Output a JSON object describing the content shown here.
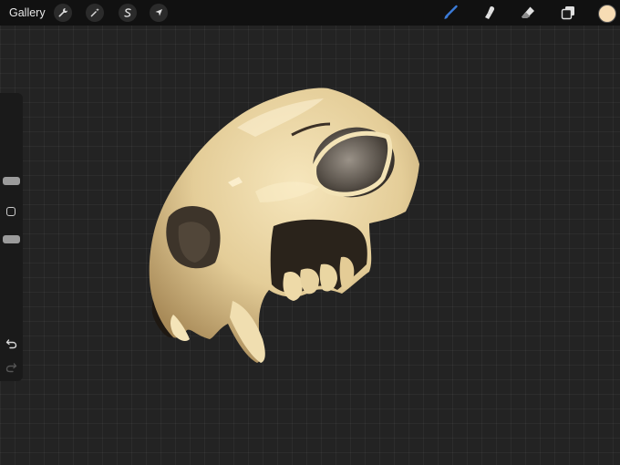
{
  "topbar": {
    "gallery_label": "Gallery",
    "actions_icon": "wrench-icon",
    "adjustments_icon": "magic-wand-icon",
    "selection_icon": "selection-s-icon",
    "transform_icon": "arrow-cursor-icon",
    "brush_icon": "brush-icon",
    "smudge_icon": "smudge-finger-icon",
    "eraser_icon": "eraser-icon",
    "layers_icon": "layers-icon",
    "color_swatch": "#f7dcb4"
  },
  "sidebar": {
    "brush_size_label": "",
    "opacity_label": "",
    "undo_icon": "undo-icon",
    "redo_icon": "redo-icon"
  },
  "colors": {
    "canvas_bg": "#232323",
    "active_brush": "#3b7bd8",
    "skull_light": "#f2dfae",
    "skull_mid": "#cdb07a",
    "skull_dark": "#3a2e22"
  }
}
